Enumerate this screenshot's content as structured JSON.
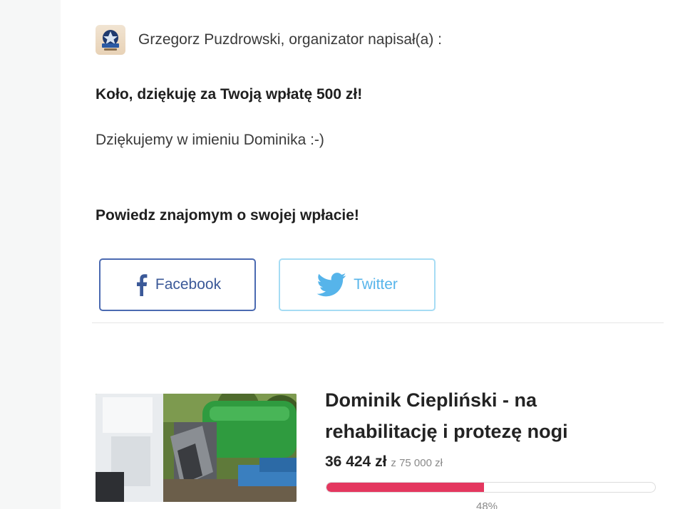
{
  "author": {
    "avatar_icon": "organization-logo-avatar",
    "text": "Grzegorz Puzdrowski, organizator napisał(a) :"
  },
  "message": {
    "thanks": "Koło, dziękuję za Twoją wpłatę 500 zł!",
    "body": "Dziękujemy w imieniu Dominika :-)"
  },
  "share": {
    "heading": "Powiedz znajomym o swojej wpłacie!",
    "facebook_label": "Facebook",
    "twitter_label": "Twitter",
    "facebook_icon": "facebook-icon",
    "twitter_icon": "twitter-icon",
    "colors": {
      "facebook": "#3b5998",
      "twitter": "#56b4ea"
    }
  },
  "fundraiser": {
    "image": "accident-truck-photo",
    "title": "Dominik Ciepliński - na rehabilitację i protezę nogi",
    "raised": "36 424 zł",
    "goal": "z 75 000 zł",
    "progress_fraction": 0.48,
    "progress_label": "48%",
    "progress_color": "#e4375f"
  }
}
